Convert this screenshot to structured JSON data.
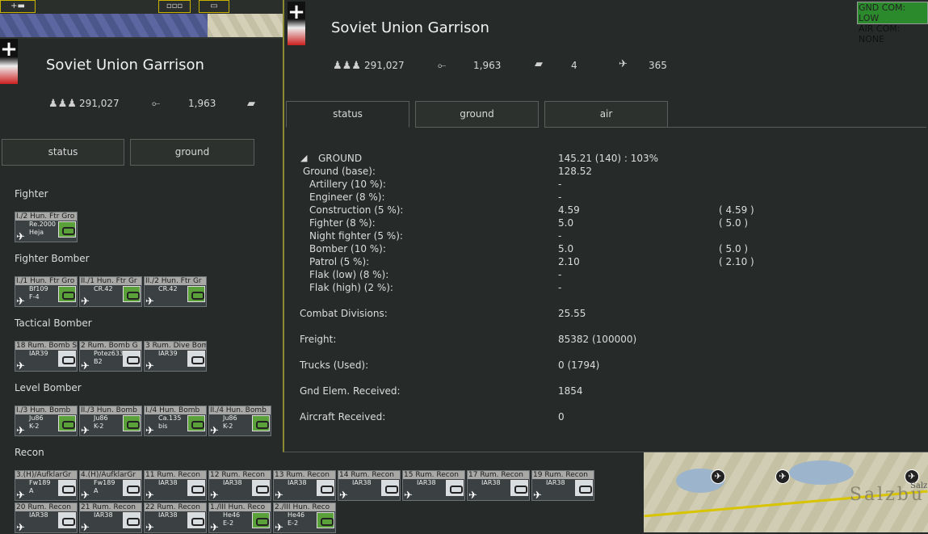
{
  "left": {
    "title": "Soviet Union Garrison",
    "stats": {
      "men": "291,027",
      "guns": "1,963"
    },
    "tabs": [
      "status",
      "ground"
    ],
    "sections": [
      "Fighter",
      "Fighter Bomber",
      "Tactical Bomber",
      "Level Bomber",
      "Recon"
    ],
    "units": {
      "fighter": [
        {
          "name": "I./2 Hun. Ftr Gro",
          "aircraft": "Re.2000\nHeja",
          "badge": "green"
        }
      ],
      "fighter_bomber": [
        {
          "name": "I./1 Hun. Ftr Gro",
          "aircraft": "Bf109\nF-4",
          "badge": "green"
        },
        {
          "name": "II./1 Hun. Ftr Gr",
          "aircraft": "CR.42",
          "badge": "green"
        },
        {
          "name": "II./2 Hun. Ftr Gr",
          "aircraft": "CR.42",
          "badge": "green"
        }
      ],
      "tactical_bomber": [
        {
          "name": "18 Rum. Bomb S",
          "aircraft": "IAR39",
          "badge": "grey"
        },
        {
          "name": "2 Rum. Bomb G",
          "aircraft": "Potez633\nB2",
          "badge": "grey"
        },
        {
          "name": "3 Rum. Dive Bom",
          "aircraft": "IAR39",
          "badge": "grey"
        }
      ],
      "level_bomber": [
        {
          "name": "I./3 Hun. Bomb",
          "aircraft": "Ju86\nK-2",
          "badge": "green"
        },
        {
          "name": "II./3 Hun. Bomb",
          "aircraft": "Ju86\nK-2",
          "badge": "green"
        },
        {
          "name": "I./4 Hun. Bomb",
          "aircraft": "Ca.135\nbis",
          "badge": "green"
        },
        {
          "name": "II./4 Hun. Bomb",
          "aircraft": "Ju86\nK-2",
          "badge": "green"
        }
      ],
      "recon_row1": [
        {
          "name": "3.(H)/AufklarGr",
          "aircraft": "Fw189\nA",
          "badge": "grey"
        },
        {
          "name": "4.(H)/AufklarGr",
          "aircraft": "Fw189\nA",
          "badge": "grey"
        },
        {
          "name": "11 Rum. Recon",
          "aircraft": "IAR38",
          "badge": "grey"
        },
        {
          "name": "12 Rum. Recon",
          "aircraft": "IAR38",
          "badge": "grey"
        },
        {
          "name": "13 Rum. Recon",
          "aircraft": "IAR38",
          "badge": "grey"
        },
        {
          "name": "14 Rum. Recon",
          "aircraft": "IAR38",
          "badge": "grey"
        },
        {
          "name": "15 Rum. Recon",
          "aircraft": "IAR38",
          "badge": "grey"
        },
        {
          "name": "17 Rum. Recon",
          "aircraft": "IAR38",
          "badge": "grey"
        },
        {
          "name": "19 Rum. Recon",
          "aircraft": "IAR38",
          "badge": "grey"
        }
      ],
      "recon_row2": [
        {
          "name": "20 Rum. Recon",
          "aircraft": "IAR38",
          "badge": "grey"
        },
        {
          "name": "21 Rum. Recon",
          "aircraft": "IAR38",
          "badge": "grey"
        },
        {
          "name": "22 Rum. Recon",
          "aircraft": "IAR38",
          "badge": "grey"
        },
        {
          "name": "1./III Hun. Reco",
          "aircraft": "He46\nE-2",
          "badge": "green"
        },
        {
          "name": "2./III Hun. Reco",
          "aircraft": "He46\nE-2",
          "badge": "green"
        }
      ]
    }
  },
  "detail": {
    "title": "Soviet Union Garrison",
    "stats": {
      "men": "291,027",
      "guns": "1,963",
      "tanks": "4",
      "aircraft": "365"
    },
    "tabs": [
      "status",
      "ground",
      "air"
    ],
    "ground_header": {
      "label": "GROUND",
      "value": "145.21  (140)  :  103%"
    },
    "rows": [
      {
        "label": "Ground (base):",
        "value": "128.52",
        "extra": ""
      },
      {
        "label": "Artillery (10 %):",
        "value": "-",
        "extra": ""
      },
      {
        "label": "Engineer (8 %):",
        "value": "-",
        "extra": ""
      },
      {
        "label": "Construction (5 %):",
        "value": "4.59",
        "extra": "( 4.59 )"
      },
      {
        "label": "Fighter (8 %):",
        "value": "5.0",
        "extra": "( 5.0 )"
      },
      {
        "label": "Night fighter (5 %):",
        "value": "-",
        "extra": ""
      },
      {
        "label": "Bomber (10 %):",
        "value": "5.0",
        "extra": "( 5.0 )"
      },
      {
        "label": "Patrol (5 %):",
        "value": "2.10",
        "extra": "( 2.10 )"
      },
      {
        "label": "Flak (low) (8 %):",
        "value": "-",
        "extra": ""
      },
      {
        "label": "Flak (high) (2 %):",
        "value": "-",
        "extra": ""
      }
    ],
    "summary": [
      {
        "label": "Combat Divisions:",
        "value": "25.55"
      },
      {
        "label": "Freight:",
        "value": "85382 (100000)"
      },
      {
        "label": "Trucks (Used):",
        "value": "0 (1794)"
      },
      {
        "label": "Gnd Elem. Received:",
        "value": "1854"
      },
      {
        "label": "Aircraft Received:",
        "value": "0"
      }
    ]
  },
  "command": {
    "gnd": "GND COM: LOW",
    "air": "AIR COM: NONE"
  },
  "map": {
    "town": "Salzbu",
    "town_small": "Salz"
  },
  "colors": {
    "accent_yellow": "#c8b200",
    "badge_green": "#5aa13a"
  }
}
